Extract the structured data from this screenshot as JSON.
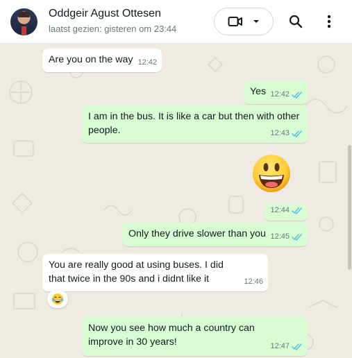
{
  "contact": {
    "name": "Oddgeir Agust Ottesen",
    "last_seen": "laatst gezien: gisteren om 23:44"
  },
  "icons": {
    "video": "video-call-icon",
    "dropdown": "chevron-down-icon",
    "search": "search-icon",
    "menu": "more-vertical-icon",
    "read": "double-check-icon",
    "big_emoji": "grinning-face-emoji",
    "reaction": "tears-of-joy-emoji"
  },
  "colors": {
    "incoming_bubble": "#ffffff",
    "outgoing_bubble": "#d9fdd3",
    "read_ticks": "#53bdeb",
    "chat_background": "#efeae2"
  },
  "messages": [
    {
      "text": "Are you on the way",
      "time": "12:42"
    },
    {
      "text": "Yes",
      "time": "12:42"
    },
    {
      "text": "I am in the bus. It is like a car but then with other people.",
      "time": "12:43"
    },
    {
      "text": "",
      "time": "12:44"
    },
    {
      "text": "Only they drive slower than you",
      "time": "12:45"
    },
    {
      "text": "You are really good at using buses. I did that twice in the 90s and i didnt like it",
      "time": "12:46"
    },
    {
      "text": "Now you see how much a country can improve in 30 years!",
      "time": "12:47"
    }
  ]
}
